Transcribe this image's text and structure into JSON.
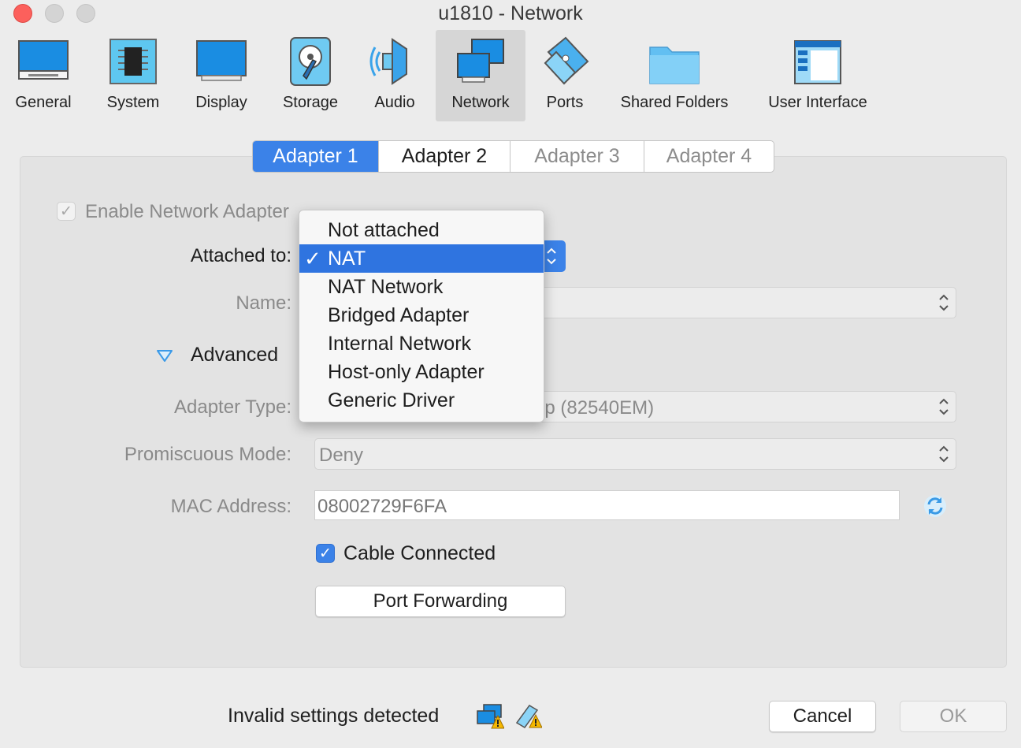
{
  "window": {
    "title": "u1810 - Network"
  },
  "toolbar": {
    "items": [
      {
        "label": "General",
        "icon": "general-icon"
      },
      {
        "label": "System",
        "icon": "chip-icon"
      },
      {
        "label": "Display",
        "icon": "monitor-icon"
      },
      {
        "label": "Storage",
        "icon": "disk-icon"
      },
      {
        "label": "Audio",
        "icon": "speaker-icon"
      },
      {
        "label": "Network",
        "icon": "network-icon",
        "selected": true
      },
      {
        "label": "Ports",
        "icon": "ports-icon"
      },
      {
        "label": "Shared Folders",
        "icon": "folder-icon"
      },
      {
        "label": "User Interface",
        "icon": "window-icon"
      }
    ]
  },
  "tabs": [
    {
      "label": "Adapter 1",
      "state": "active"
    },
    {
      "label": "Adapter 2",
      "state": "normal"
    },
    {
      "label": "Adapter 3",
      "state": "disabled"
    },
    {
      "label": "Adapter 4",
      "state": "disabled"
    }
  ],
  "form": {
    "enable_adapter": {
      "label": "Enable Network Adapter",
      "checked": true,
      "disabled": true
    },
    "attached_to": {
      "label": "Attached to:",
      "value": "NAT"
    },
    "name": {
      "label": "Name:",
      "value": ""
    },
    "advanced": {
      "label": "Advanced",
      "expanded": true
    },
    "adapter_type": {
      "label": "Adapter Type:",
      "value": "Intel PRO/1000 MT Desktop (82540EM)"
    },
    "promiscuous": {
      "label": "Promiscuous Mode:",
      "value": "Deny"
    },
    "mac": {
      "label": "MAC Address:",
      "value": "08002729F6FA"
    },
    "cable": {
      "label": "Cable Connected",
      "checked": true
    },
    "port_forwarding": {
      "label": "Port Forwarding"
    }
  },
  "dropdown": {
    "selected": "NAT",
    "options": [
      "Not attached",
      "NAT",
      "NAT Network",
      "Bridged Adapter",
      "Internal Network",
      "Host-only Adapter",
      "Generic Driver"
    ]
  },
  "footer": {
    "status": "Invalid settings detected",
    "cancel": "Cancel",
    "ok": "OK"
  },
  "colors": {
    "accent": "#3b82e8",
    "window_bg": "#ececec",
    "panel_bg": "#e3e3e3"
  }
}
